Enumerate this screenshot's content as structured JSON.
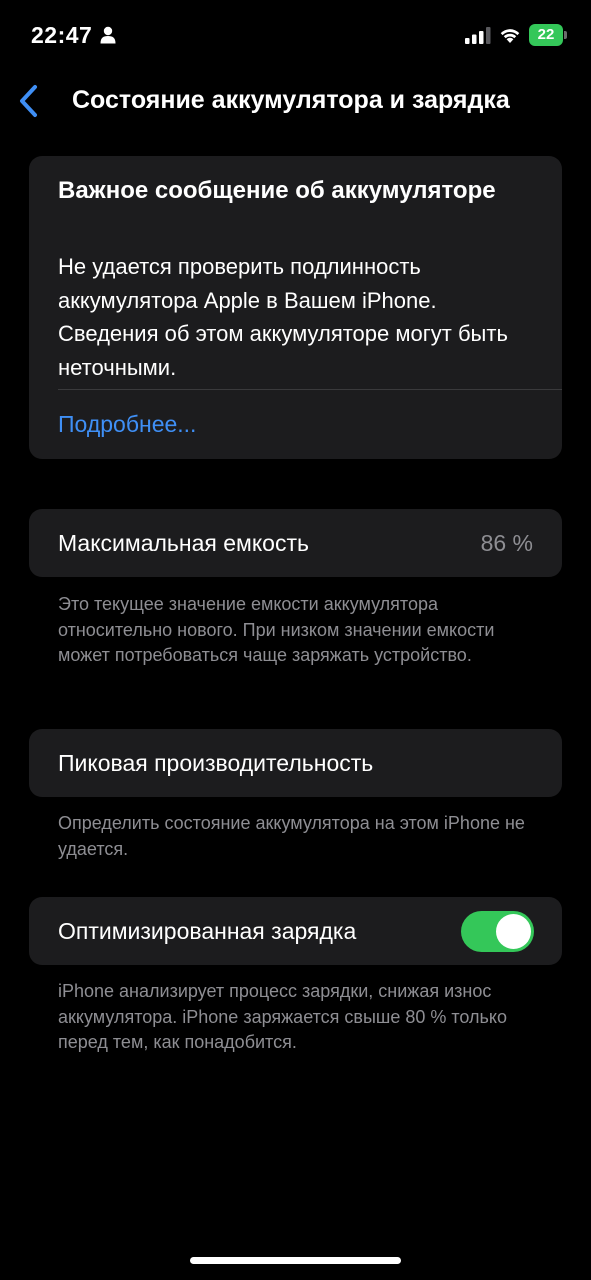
{
  "status_bar": {
    "time": "22:47",
    "battery_level": "22",
    "icons": [
      "person-icon",
      "cellular-signal-icon",
      "wifi-icon",
      "battery-icon"
    ],
    "battery_color": "#34c759"
  },
  "nav": {
    "back_icon": "chevron-left-icon",
    "title": "Состояние аккумулятора и зарядка"
  },
  "alert": {
    "title": "Важное сообщение об аккумуляторе",
    "body": "Не удается проверить подлинность аккумулятора Apple в Вашем iPhone. Сведения об этом аккумуляторе могут быть неточными.",
    "link_label": "Подробнее..."
  },
  "max_capacity": {
    "label": "Максимальная емкость",
    "value": "86 %",
    "note": "Это текущее значение емкости аккумулятора относительно нового. При низком значении емкости может потребоваться чаще заряжать устройство."
  },
  "peak_performance": {
    "label": "Пиковая производительность",
    "note": "Определить состояние аккумулятора на этом iPhone не удается."
  },
  "optimized_charging": {
    "label": "Оптимизированная зарядка",
    "enabled": true,
    "toggle_color": "#34c759",
    "note": "iPhone анализирует процесс зарядки, снижая износ аккумулятора. iPhone заряжается свыше 80 % только перед тем, как понадобится."
  },
  "colors": {
    "background": "#000000",
    "card": "#1c1c1e",
    "link": "#3f8ff5",
    "secondary_text": "#8e8e93"
  }
}
